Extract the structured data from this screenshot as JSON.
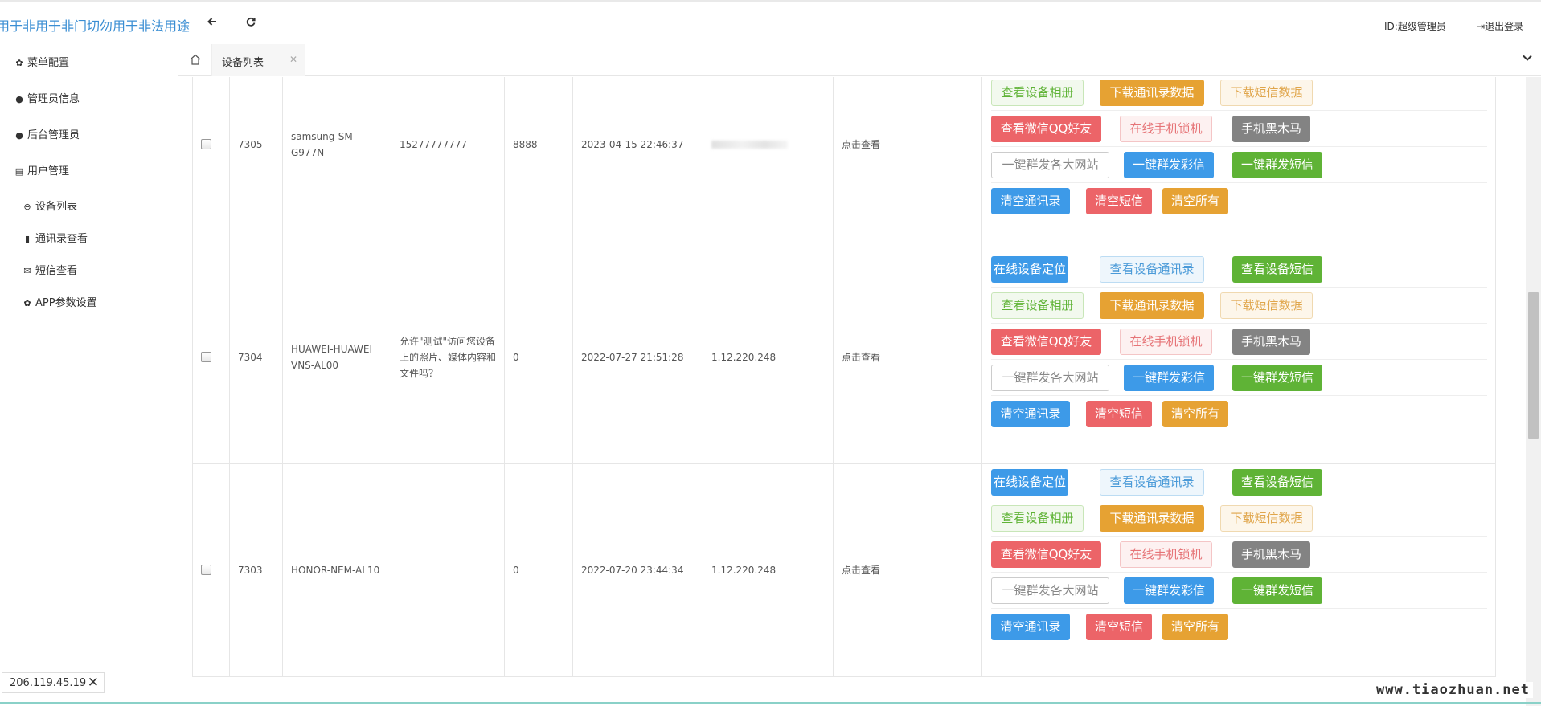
{
  "header": {
    "brand": "用于非用于非门切勿用于非法用途",
    "user_label": "ID:超级管理员",
    "logout_label": "退出登录"
  },
  "sidebar": {
    "items": [
      {
        "label": "菜单配置",
        "icon": "gear-icon"
      },
      {
        "label": "管理员信息",
        "icon": "user-icon"
      },
      {
        "label": "后台管理员",
        "icon": "user-icon"
      },
      {
        "label": "用户管理",
        "icon": "id-card-icon"
      },
      {
        "label": "设备列表",
        "icon": "lock-icon"
      },
      {
        "label": "通讯录查看",
        "icon": "phone-book-icon"
      },
      {
        "label": "短信查看",
        "icon": "envelope-icon"
      },
      {
        "label": "APP参数设置",
        "icon": "gear-icon"
      }
    ],
    "ip_chip": "206.119.45.19"
  },
  "tabs": {
    "active_tab": "设备列表"
  },
  "rows": [
    {
      "id": "7305",
      "model": [
        "samsung-SM-",
        "G977N"
      ],
      "phone": [
        "15277777777"
      ],
      "code": "8888",
      "time": "2023-04-15 22:46:37",
      "ip": "",
      "ip_hidden": true,
      "view": "点击查看"
    },
    {
      "id": "7304",
      "model": [
        "HUAWEI-HUAWEI",
        "VNS-AL00"
      ],
      "phone": [
        "允许\"测试\"访问您设备",
        "上的照片、媒体内容和",
        "文件吗？"
      ],
      "code": "0",
      "time": "2022-07-27 21:51:28",
      "ip": "1.12.220.248",
      "ip_hidden": false,
      "view": "点击查看"
    },
    {
      "id": "7303",
      "model": [
        "HONOR-NEM-AL10"
      ],
      "phone": [],
      "code": "0",
      "time": "2022-07-20 23:44:34",
      "ip": "1.12.220.248",
      "ip_hidden": false,
      "view": "点击查看"
    }
  ],
  "actions": [
    [
      {
        "label": "在线设备定位",
        "style": "b-blue"
      },
      {
        "label": "查看设备通讯录",
        "style": "o-blue"
      },
      {
        "label": "查看设备短信",
        "style": "b-green"
      }
    ],
    [
      {
        "label": "查看设备相册",
        "style": "o-green"
      },
      {
        "label": "下载通讯录数据",
        "style": "b-orange"
      },
      {
        "label": "下载短信数据",
        "style": "o-orange"
      }
    ],
    [
      {
        "label": "查看微信QQ好友",
        "style": "b-red"
      },
      {
        "label": "在线手机锁机",
        "style": "o-red"
      },
      {
        "label": "手机黑木马",
        "style": "b-gray"
      }
    ],
    [
      {
        "label": "一键群发各大网站",
        "style": "o-gray"
      },
      {
        "label": "一键群发彩信",
        "style": "b-blue"
      },
      {
        "label": "一键群发短信",
        "style": "b-green"
      }
    ],
    [
      {
        "label": "清空通讯录",
        "style": "b-blue"
      },
      {
        "label": "清空短信",
        "style": "b-red"
      },
      {
        "label": "清空所有",
        "style": "b-orange"
      }
    ]
  ],
  "watermark": "www.tiaozhuan.net"
}
